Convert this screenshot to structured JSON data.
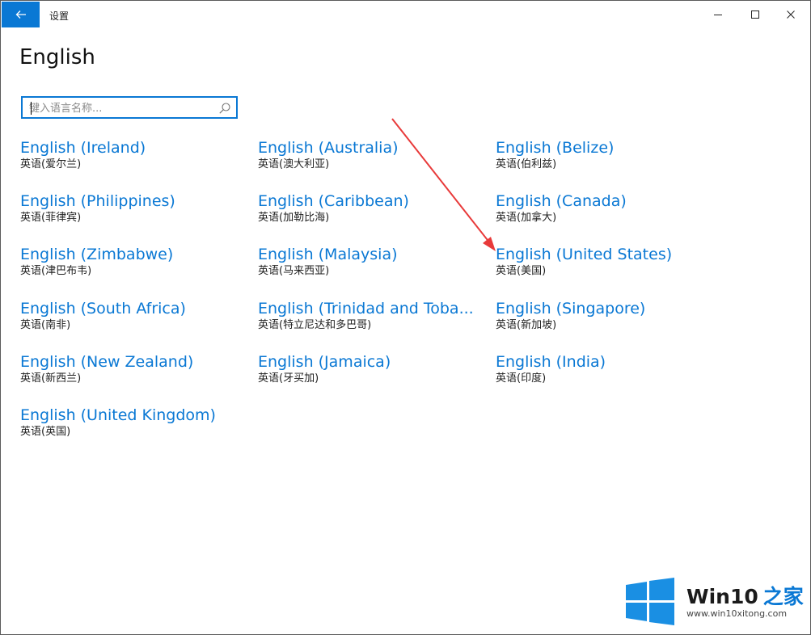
{
  "window": {
    "title": "设置"
  },
  "page": {
    "heading": "English"
  },
  "search": {
    "placeholder": "键入语言名称..."
  },
  "languages": [
    {
      "name": "English (Ireland)",
      "native": "英语(爱尔兰)"
    },
    {
      "name": "English (Australia)",
      "native": "英语(澳大利亚)"
    },
    {
      "name": "English (Belize)",
      "native": "英语(伯利兹)"
    },
    {
      "name": "English (Philippines)",
      "native": "英语(菲律宾)"
    },
    {
      "name": "English (Caribbean)",
      "native": "英语(加勒比海)"
    },
    {
      "name": "English (Canada)",
      "native": "英语(加拿大)"
    },
    {
      "name": "English (Zimbabwe)",
      "native": "英语(津巴布韦)"
    },
    {
      "name": "English (Malaysia)",
      "native": "英语(马来西亚)"
    },
    {
      "name": "English (United States)",
      "native": "英语(美国)"
    },
    {
      "name": "English (South Africa)",
      "native": "英语(南非)"
    },
    {
      "name": "English (Trinidad and Toba...",
      "native": "英语(特立尼达和多巴哥)"
    },
    {
      "name": "English (Singapore)",
      "native": "英语(新加坡)"
    },
    {
      "name": "English (New Zealand)",
      "native": "英语(新西兰)"
    },
    {
      "name": "English (Jamaica)",
      "native": "英语(牙买加)"
    },
    {
      "name": "English (India)",
      "native": "英语(印度)"
    },
    {
      "name": "English (United Kingdom)",
      "native": "英语(英国)"
    }
  ],
  "watermark": {
    "brand": "Win10",
    "suffix": "之家",
    "url": "www.win10xitong.com"
  },
  "colors": {
    "accent": "#0a78d4",
    "annotation_arrow": "#e83a3a"
  },
  "icons": {
    "back": "back-arrow-icon",
    "minimize": "minimize-icon",
    "maximize": "maximize-icon",
    "close": "close-icon",
    "search": "search-icon"
  }
}
